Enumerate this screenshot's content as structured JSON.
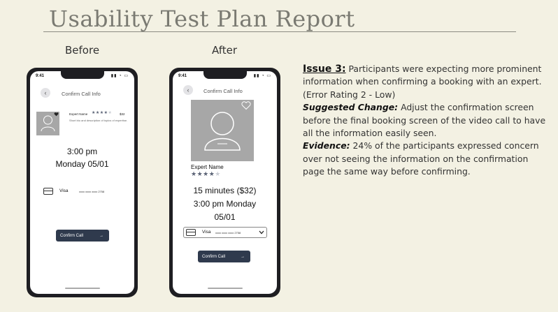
{
  "title": "Usability Test Plan Report",
  "labels": {
    "before": "Before",
    "after": "After"
  },
  "before": {
    "status_time": "9:41",
    "screen_title": "Confirm Call Info",
    "expert_name": "Expert Name",
    "rating_stars": "★★★★★",
    "rating_filled": 4,
    "price": "$32",
    "bio": "Short bio and description of topics of expertise.",
    "time": "3:00 pm",
    "date": "Monday 05/01",
    "card_brand": "Visa",
    "card_number": "xxxx xxxx xxxx 2758",
    "confirm_label": "Confirm Call",
    "arrow": "→"
  },
  "after": {
    "status_time": "9:41",
    "screen_title": "Confirm Call Info",
    "expert_name": "Expert Name",
    "rating_filled": 4,
    "duration_price": "15 minutes ($32)",
    "time_line1": "3:00 pm Monday",
    "time_line2": "05/01",
    "card_brand": "Visa",
    "card_number": "xxxx xxxx xxxx 2758",
    "confirm_label": "Confirm Call",
    "arrow": "→"
  },
  "issue": {
    "heading": "Issue 3:",
    "text": "Participants were expecting more prominent information when confirming a booking with an expert. (Error Rating 2 - Low)",
    "change_label": "Suggested Change:",
    "change_text": "Adjust the confirmation screen before the final booking screen of the video call to have all the information easily seen.",
    "evidence_label": "Evidence:",
    "evidence_text": "24% of the participants expressed concern over not seeing the information on the confirmation page the same way before confirming."
  }
}
